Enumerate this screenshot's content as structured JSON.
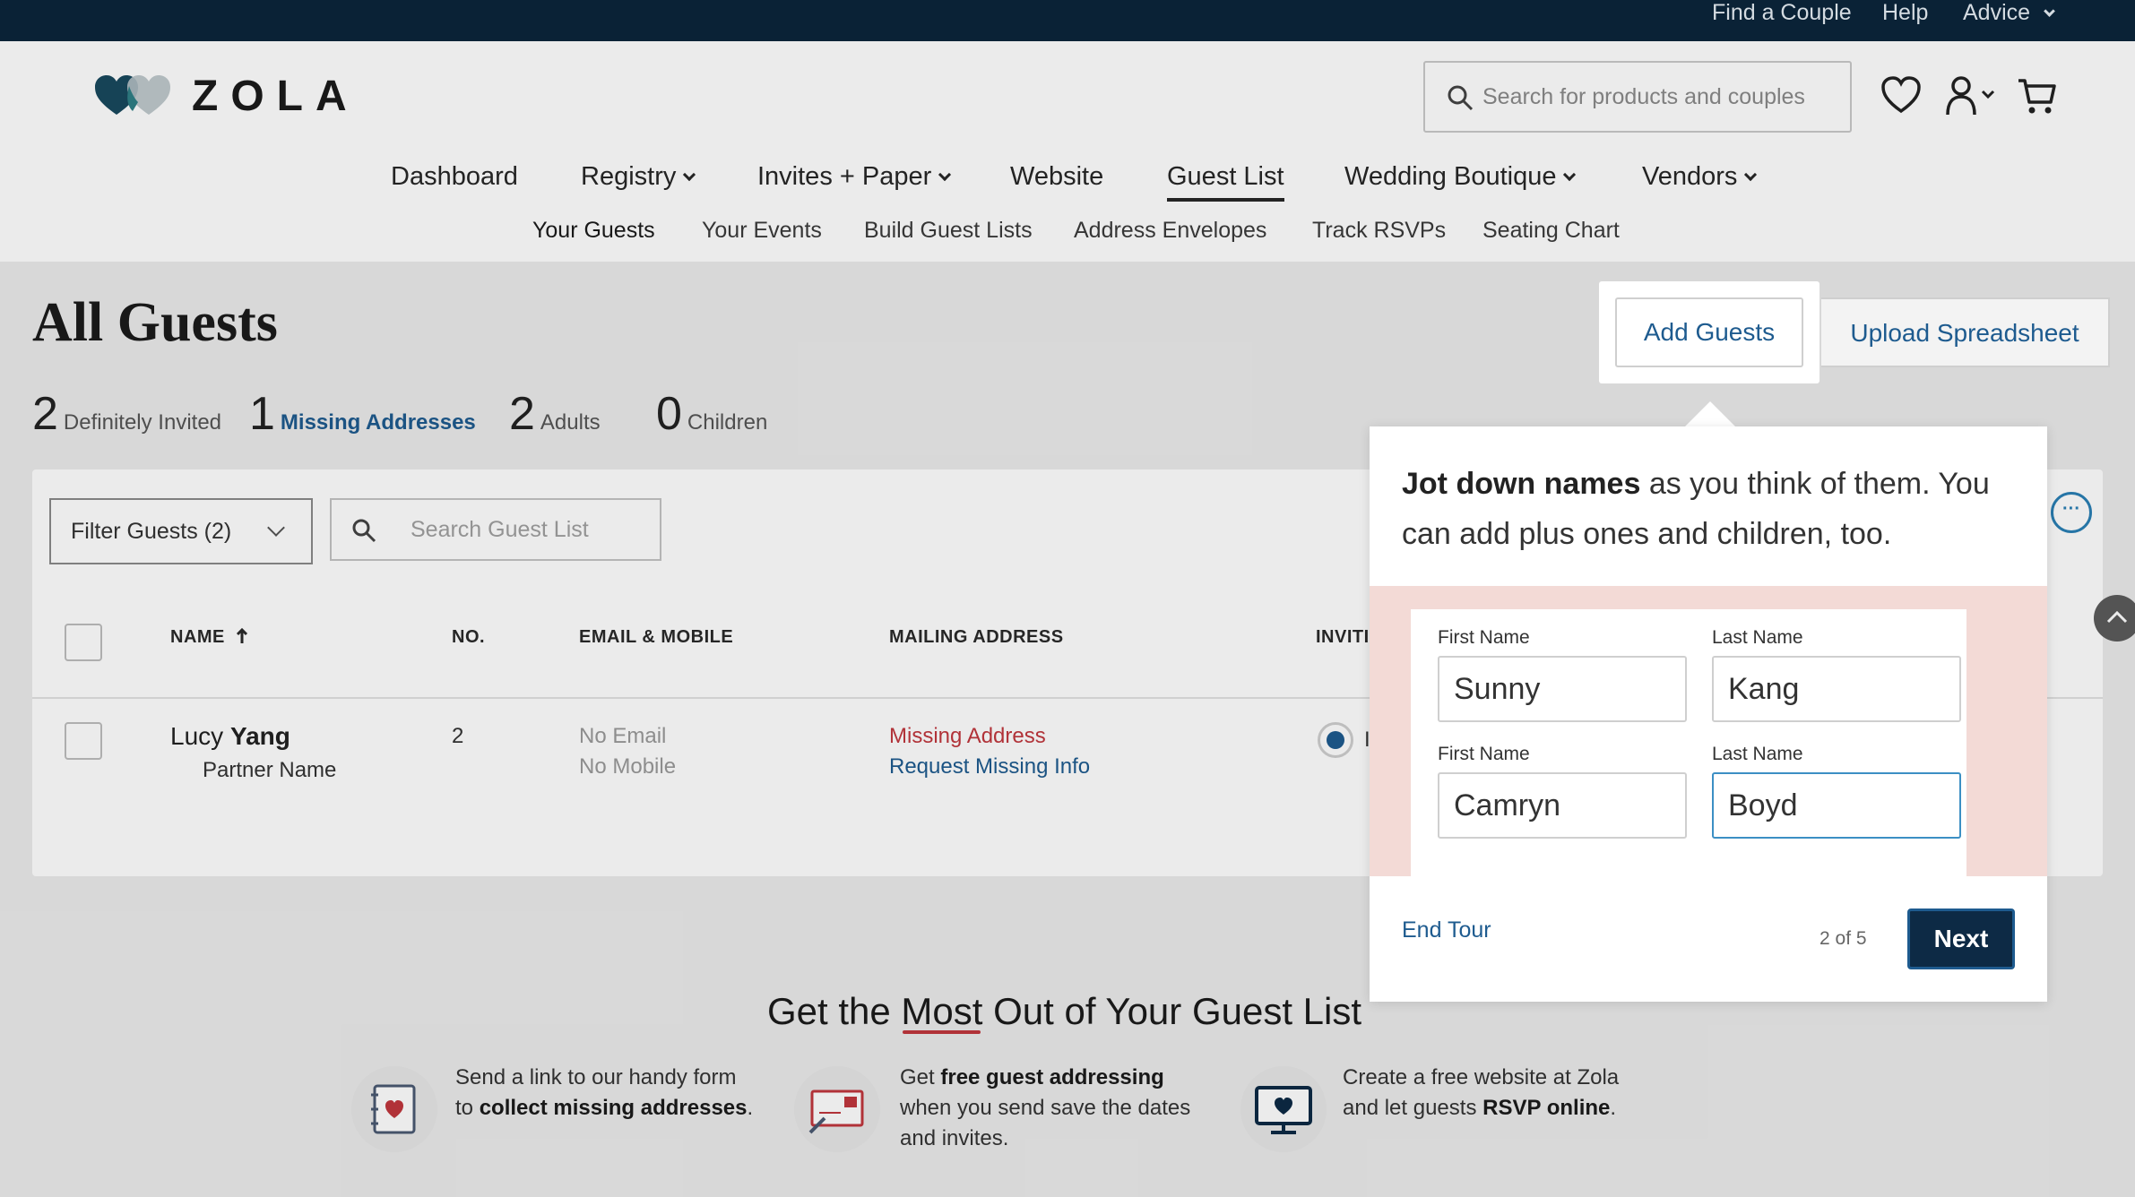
{
  "utility_nav": {
    "find_couple": "Find a Couple",
    "help": "Help",
    "advice": "Advice"
  },
  "header": {
    "logo_text": "ZOLA",
    "search_placeholder": "Search for products and couples"
  },
  "main_nav": [
    {
      "label": "Dashboard"
    },
    {
      "label": "Registry"
    },
    {
      "label": "Invites + Paper"
    },
    {
      "label": "Website"
    },
    {
      "label": "Guest List"
    },
    {
      "label": "Wedding Boutique"
    },
    {
      "label": "Vendors"
    }
  ],
  "sub_nav": [
    {
      "label": "Your Guests"
    },
    {
      "label": "Your Events"
    },
    {
      "label": "Build Guest Lists"
    },
    {
      "label": "Address Envelopes"
    },
    {
      "label": "Track RSVPs"
    },
    {
      "label": "Seating Chart"
    }
  ],
  "page": {
    "title": "All Guests",
    "add_guests": "Add Guests",
    "upload_spreadsheet": "Upload Spreadsheet"
  },
  "stats": [
    {
      "num": "2",
      "label": "Definitely Invited"
    },
    {
      "num": "1",
      "label": "Missing Addresses"
    },
    {
      "num": "2",
      "label": "Adults"
    },
    {
      "num": "0",
      "label": "Children"
    }
  ],
  "toolbar": {
    "filter_label": "Filter Guests (2)",
    "search_placeholder": "Search Guest List",
    "more": "···"
  },
  "table": {
    "headers": {
      "name": "NAME",
      "no": "NO.",
      "email": "EMAIL & MOBILE",
      "address": "MAILING ADDRESS",
      "invited": "INVITI"
    },
    "rows": [
      {
        "first": "Lucy",
        "last": "Yang",
        "partner": "Partner Name",
        "no": "2",
        "email": "No Email",
        "mobile": "No Mobile",
        "address_status": "Missing Address",
        "request": "Request Missing Info",
        "invite_cut": "I"
      }
    ]
  },
  "promo": {
    "title_pre": "Get the ",
    "title_mid": "Most",
    "title_post": " Out of Your Guest List",
    "items": [
      {
        "pre": "Send a link to our handy form to ",
        "bold": "collect missing addresses",
        "post": "."
      },
      {
        "pre": "Get ",
        "bold": "free guest addressing",
        "post": " when you send save the dates and invites."
      },
      {
        "pre": "Create a free website at Zola and let guests ",
        "bold": "RSVP online",
        "post": "."
      }
    ]
  },
  "tour": {
    "bold": "Jot down names",
    "text": " as you think of them. You can add plus ones and children, too.",
    "first_label": "First Name",
    "last_label": "Last Name",
    "rows": [
      {
        "first": "Sunny",
        "last": "Kang"
      },
      {
        "first": "Camryn",
        "last": "Boyd"
      }
    ],
    "end_tour": "End Tour",
    "step": "2 of 5",
    "next": "Next"
  },
  "colors": {
    "topbar": "#0a2236",
    "link": "#1e5b8f",
    "alert": "#c0373d",
    "next_button": "#0d2a45",
    "pink_band": "#f3dad6"
  }
}
